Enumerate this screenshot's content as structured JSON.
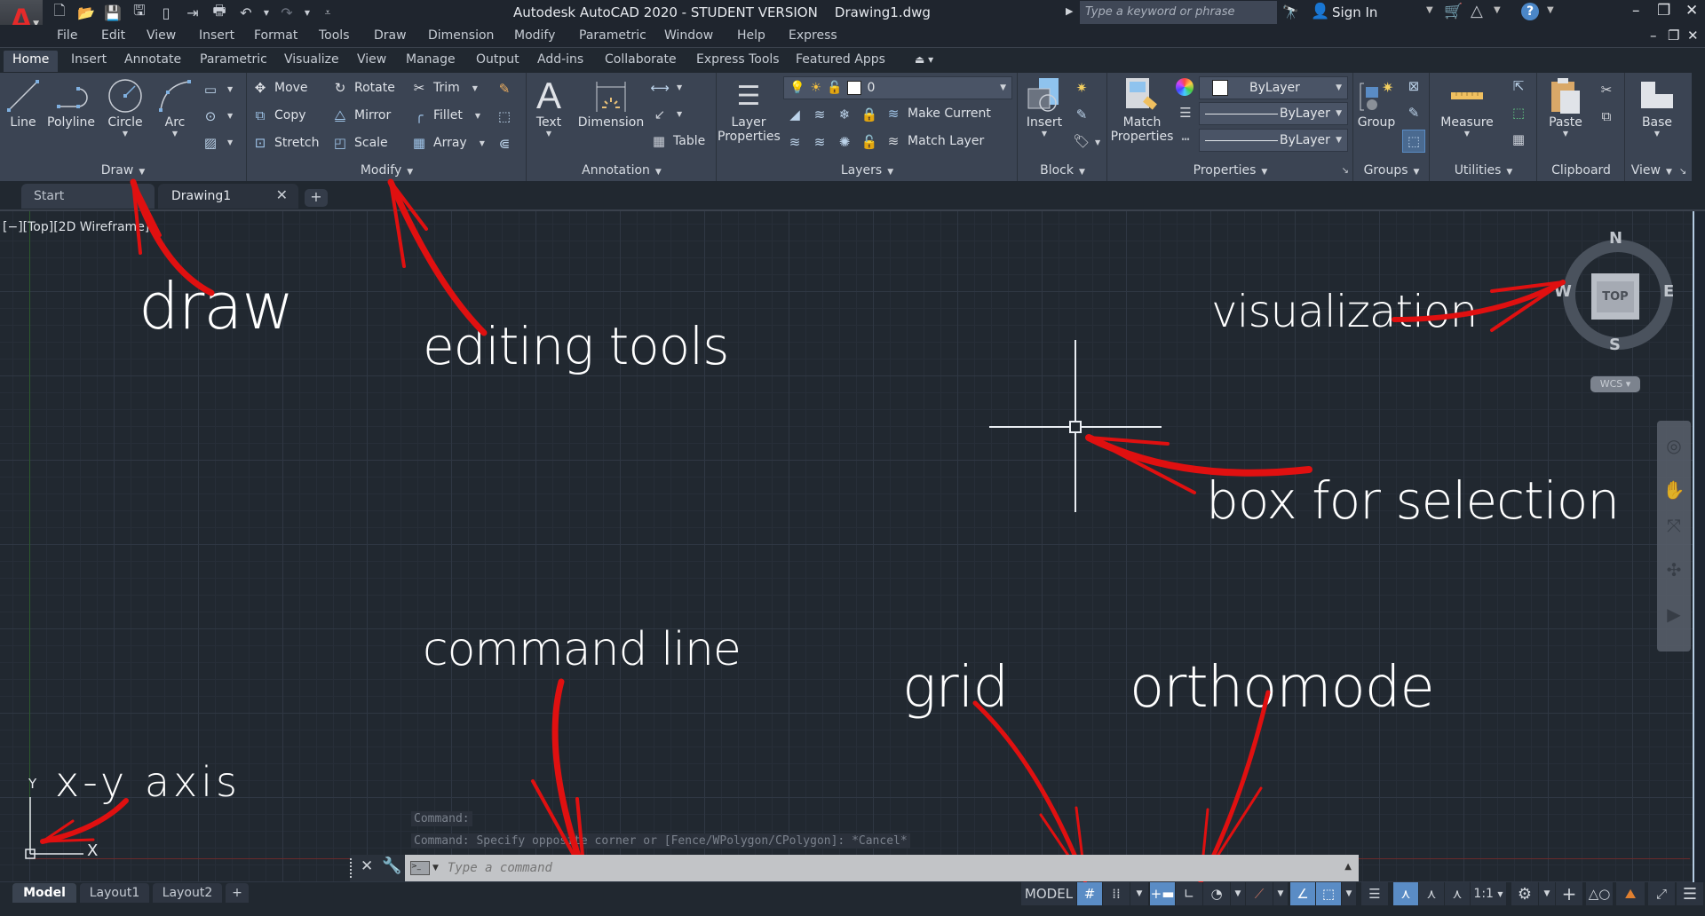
{
  "titlebar": {
    "app_logo": "A",
    "quick_access": [
      "new-icon",
      "open-icon",
      "save-icon",
      "save-as-icon",
      "open-from-web-icon",
      "save-to-web-icon",
      "plot-icon",
      "undo-icon",
      "redo-icon",
      "customize-icon"
    ],
    "title": "Autodesk AutoCAD 2020 - STUDENT VERSION    Drawing1.dwg",
    "search_placeholder": "Type a keyword or phrase",
    "sign_in": "Sign In",
    "window_controls": {
      "minimize": "–",
      "restore": "❐",
      "close": "✕"
    }
  },
  "menubar": {
    "items": [
      "File",
      "Edit",
      "View",
      "Insert",
      "Format",
      "Tools",
      "Draw",
      "Dimension",
      "Modify",
      "Parametric",
      "Window",
      "Help",
      "Express"
    ]
  },
  "ribbon_tabs": {
    "items": [
      "Home",
      "Insert",
      "Annotate",
      "Parametric",
      "Visualize",
      "View",
      "Manage",
      "Output",
      "Add-ins",
      "Collaborate",
      "Express Tools",
      "Featured Apps"
    ],
    "active": "Home"
  },
  "ribbon": {
    "draw": {
      "title": "Draw",
      "buttons": [
        "Line",
        "Polyline",
        "Circle",
        "Arc"
      ]
    },
    "modify": {
      "title": "Modify",
      "buttons": [
        "Move",
        "Rotate",
        "Trim",
        "Copy",
        "Mirror",
        "Fillet",
        "Stretch",
        "Scale",
        "Array"
      ]
    },
    "annotation": {
      "title": "Annotation",
      "buttons": [
        "Text",
        "Dimension",
        "Table"
      ]
    },
    "layers": {
      "title": "Layers",
      "layer_properties": "Layer\nProperties",
      "layer_properties_l1": "Layer",
      "layer_properties_l2": "Properties",
      "current_layer": "0",
      "make_current": "Make Current",
      "match_layer": "Match Layer"
    },
    "block": {
      "title": "Block",
      "insert": "Insert"
    },
    "properties": {
      "title": "Properties",
      "match_l1": "Match",
      "match_l2": "Properties",
      "color": "ByLayer",
      "lineweight": "ByLayer",
      "linetype": "ByLayer"
    },
    "groups": {
      "title": "Groups",
      "group": "Group"
    },
    "utilities": {
      "title": "Utilities",
      "measure": "Measure"
    },
    "clipboard": {
      "title": "Clipboard",
      "paste": "Paste"
    },
    "view": {
      "title": "View",
      "base": "Base"
    }
  },
  "file_tabs": {
    "items": [
      "Start",
      "Drawing1"
    ],
    "active": "Drawing1",
    "add": "+"
  },
  "viewport": {
    "label": "[−][Top][2D Wireframe]",
    "viewcube": {
      "n": "N",
      "s": "S",
      "e": "E",
      "w": "W",
      "face": "TOP",
      "ucs": "WCS"
    },
    "ucs_icon": {
      "x": "X",
      "y": "Y"
    }
  },
  "annotations": {
    "draw": "draw",
    "editing_tools": "editing tools",
    "visualization": "visualization",
    "box_for_selection": "box for selection",
    "command_line": "command line",
    "grid": "grid",
    "orthomode": "orthomode",
    "xy_axis": "x-y axis"
  },
  "command_history": [
    "Command:",
    "Command: Specify opposite corner or [Fence/WPolygon/CPolygon]: *Cancel*"
  ],
  "command_line": {
    "placeholder": "Type a command"
  },
  "layout_tabs": {
    "items": [
      "Model",
      "Layout1",
      "Layout2"
    ],
    "active": "Model",
    "add": "+"
  },
  "statusbar": {
    "model": "MODEL",
    "grid_on": true,
    "snap_on": false,
    "infer_constraints_on": true,
    "ortho_on": false,
    "isodraft_on": true,
    "object_snap_on": true,
    "annotation_visibility_on": true,
    "annotation_scale": "1:1"
  },
  "colors": {
    "background": "#212830",
    "ribbon": "#3b4453",
    "accent": "#5a8cc5",
    "annotation_arrow": "#e01010",
    "logo_red": "#e52a2a"
  }
}
